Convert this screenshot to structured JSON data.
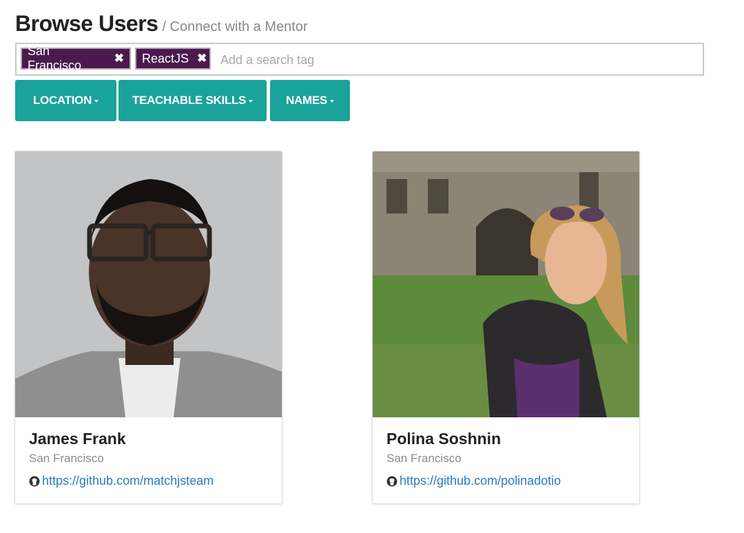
{
  "header": {
    "title": "Browse Users",
    "subtitle": "/ Connect with a Mentor"
  },
  "search": {
    "tags": [
      {
        "label": "San Francisco",
        "remove": "✖"
      },
      {
        "label": "ReactJS",
        "remove": "✖"
      }
    ],
    "placeholder": "Add a search tag"
  },
  "filters": {
    "location": "LOCATION",
    "skills": "TEACHABLE SKILLS",
    "names": "NAMES"
  },
  "users": [
    {
      "name": "James Frank",
      "location": "San Francisco",
      "github": "https://github.com/matchjsteam"
    },
    {
      "name": "Polina Soshnin",
      "location": "San Francisco",
      "github": "https://github.com/polinadotio"
    }
  ],
  "colors": {
    "accent": "#1aa39a",
    "tag_bg": "#4a1a4f",
    "link": "#2a7bbf"
  }
}
